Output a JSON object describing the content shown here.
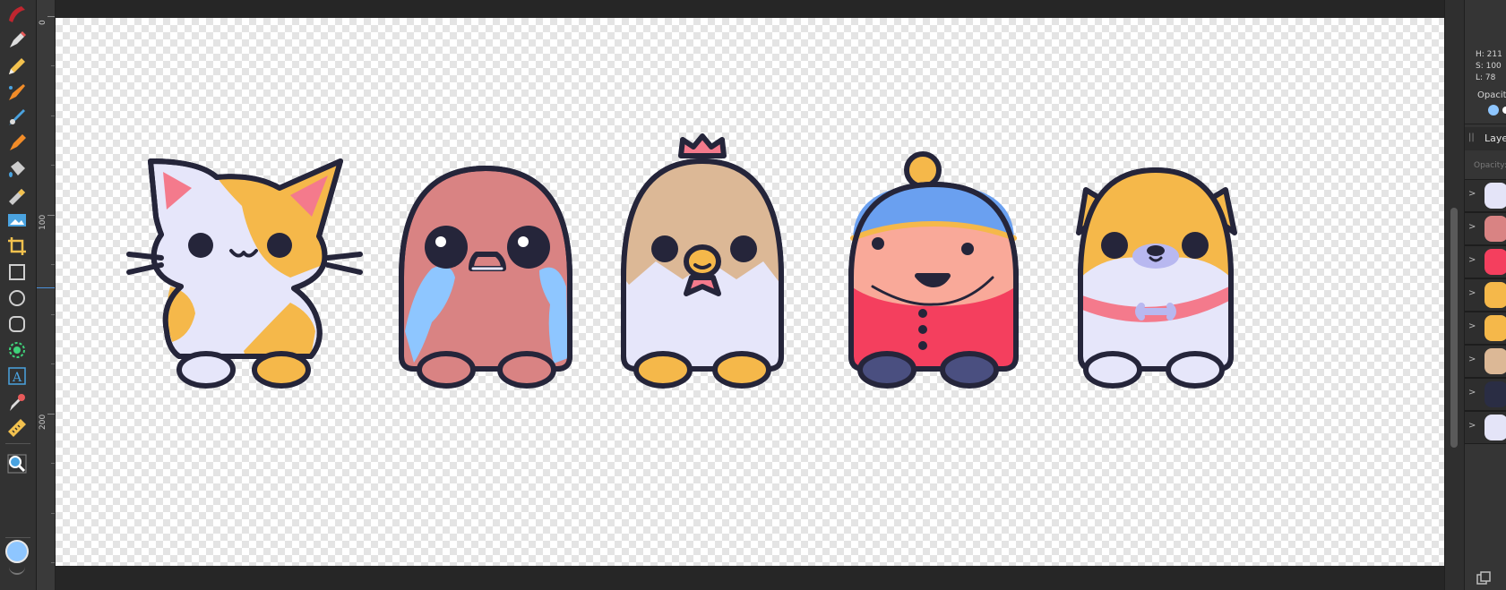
{
  "toolbox": {
    "tools": [
      {
        "name": "brush-tool-icon",
        "color": "#c0262f"
      },
      {
        "name": "pen-tool-icon",
        "color": "#e85a5a"
      },
      {
        "name": "pencil-tool-icon",
        "color": "#f2c14e"
      },
      {
        "name": "vector-brush-tool-icon",
        "color": "#f28c28"
      },
      {
        "name": "paint-brush-tool-icon",
        "color": "#4aa3e0"
      },
      {
        "name": "pixel-tool-icon",
        "color": "#f28c28"
      },
      {
        "name": "fill-tool-icon",
        "color": "#4aa3e0"
      },
      {
        "name": "gradient-tool-icon",
        "color": "#f2c14e"
      },
      {
        "name": "place-image-tool-icon",
        "color": "#4aa3e0"
      },
      {
        "name": "crop-tool-icon",
        "color": "#f2c14e"
      },
      {
        "name": "rectangle-tool-icon",
        "color": "#cfcfcf"
      },
      {
        "name": "ellipse-tool-icon",
        "color": "#cfcfcf"
      },
      {
        "name": "rounded-rectangle-tool-icon",
        "color": "#cfcfcf"
      },
      {
        "name": "selection-brush-tool-icon",
        "color": "#3fd27a"
      },
      {
        "name": "artistic-text-tool-icon",
        "color": "#4aa3e0"
      },
      {
        "name": "color-picker-tool-icon",
        "color": "#e85a5a"
      },
      {
        "name": "measure-tool-icon",
        "color": "#f2c14e"
      },
      {
        "name": "zoom-tool-icon",
        "color": "#4aa3e0"
      }
    ],
    "primary_color": "#8ec6ff"
  },
  "ruler": {
    "labels": [
      "0",
      "100",
      "200"
    ]
  },
  "color_panel": {
    "h": "H: 211",
    "s": "S: 100",
    "l": "L: 78",
    "opacity_label": "Opacity"
  },
  "layers_panel": {
    "title": "Layers",
    "opacity_label": "Opacity:",
    "expand_glyph": ">",
    "layer_thumbs": [
      {
        "name": "ghost-layer",
        "color": "#e4e4f8"
      },
      {
        "name": "crying-seal-layer",
        "color": "#d98383"
      },
      {
        "name": "kid-layer",
        "color": "#f43f5e"
      },
      {
        "name": "dog-layer",
        "color": "#f5b84a"
      },
      {
        "name": "cat-layer",
        "color": "#f5b84a"
      },
      {
        "name": "bird-layer",
        "color": "#dcb896"
      },
      {
        "name": "monster-layer",
        "color": "#2a2d44"
      },
      {
        "name": "ghost2-layer",
        "color": "#e4e4f8"
      }
    ]
  },
  "artwork": {
    "characters": [
      "cat",
      "crying-blob",
      "chicken",
      "kid-with-hat",
      "dog"
    ],
    "colors": {
      "outline": "#25253a",
      "white": "#e6e6fa",
      "orange": "#f5b84a",
      "pink": "#f47a8c",
      "salmon": "#d98383",
      "tear": "#8ec6ff",
      "tan": "#dcb896",
      "blue": "#6aa0f0",
      "skin": "#f9a999",
      "red": "#f43f5e",
      "navy": "#4a4f80",
      "lavender": "#b8b8f0"
    }
  }
}
